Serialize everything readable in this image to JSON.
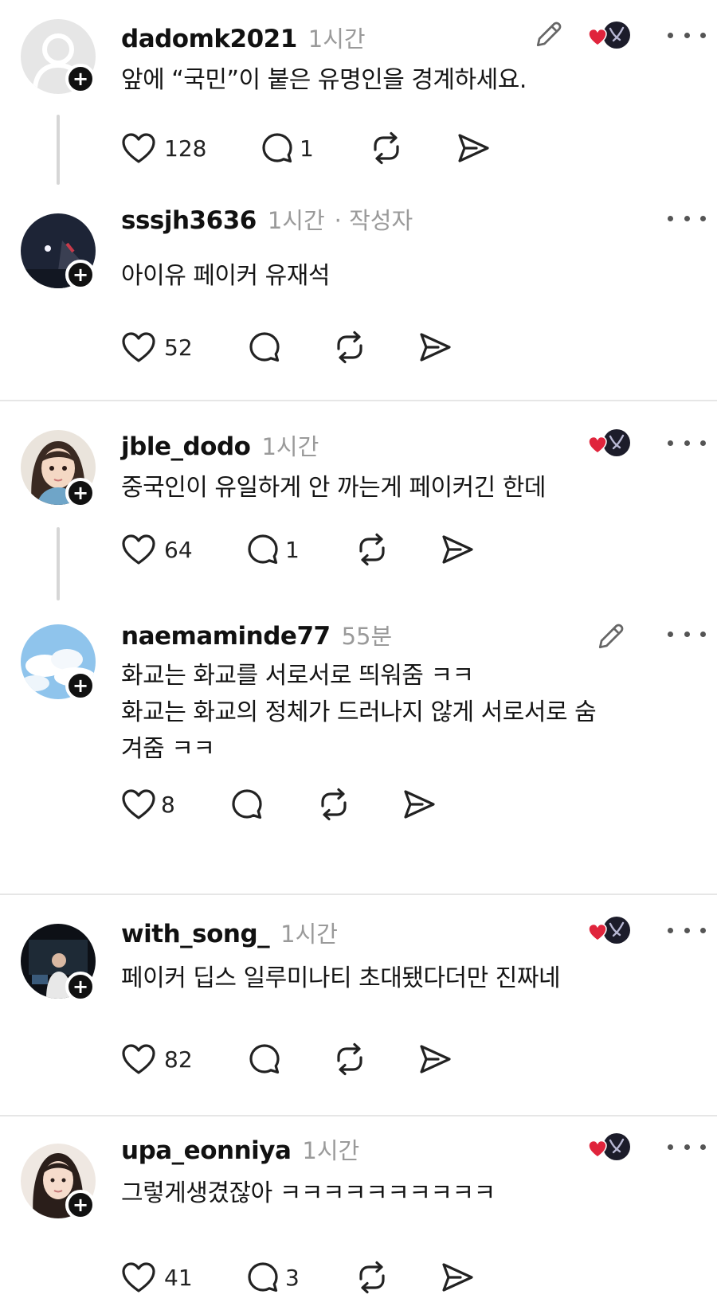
{
  "colors": {
    "meta": "#9a9a9a",
    "heart": "#e0243c",
    "divider": "#e6e6e6"
  },
  "posts": [
    {
      "username": "dadomk2021",
      "time": "1시간",
      "author_tag": "",
      "lines": [
        "앞에 “국민”이 붙은 유명인을 경계하세요."
      ],
      "likes": "128",
      "replies": "1",
      "has_edit": true,
      "has_badge": true
    },
    {
      "username": "sssjh3636",
      "time": "1시간",
      "author_tag": "· 작성자",
      "lines": [
        "아이유 페이커 유재석"
      ],
      "likes": "52",
      "replies": "",
      "has_edit": false,
      "has_badge": false
    },
    {
      "username": "jble_dodo",
      "time": "1시간",
      "author_tag": "",
      "lines": [
        "중국인이 유일하게 안 까는게 페이커긴 한데"
      ],
      "likes": "64",
      "replies": "1",
      "has_edit": false,
      "has_badge": true
    },
    {
      "username": "naemaminde77",
      "time": "55분",
      "author_tag": "",
      "lines": [
        "화교는 화교를 서로서로 띄워줌 ㅋㅋ",
        "화교는 화교의 정체가 드러나지 않게 서로서로 숨",
        "겨줌 ㅋㅋ"
      ],
      "likes": "8",
      "replies": "",
      "has_edit": true,
      "has_badge": false
    },
    {
      "username": "with_song_",
      "time": "1시간",
      "author_tag": "",
      "lines": [
        "페이커 딥스 일루미나티 초대됐다더만 진짜네"
      ],
      "likes": "82",
      "replies": "",
      "has_edit": false,
      "has_badge": true
    },
    {
      "username": "upa_eonniya",
      "time": "1시간",
      "author_tag": "",
      "lines": [
        "그렇게생겼잖아 ㅋㅋㅋㅋㅋㅋㅋㅋㅋㅋ"
      ],
      "likes": "41",
      "replies": "3",
      "has_edit": false,
      "has_badge": true
    }
  ]
}
